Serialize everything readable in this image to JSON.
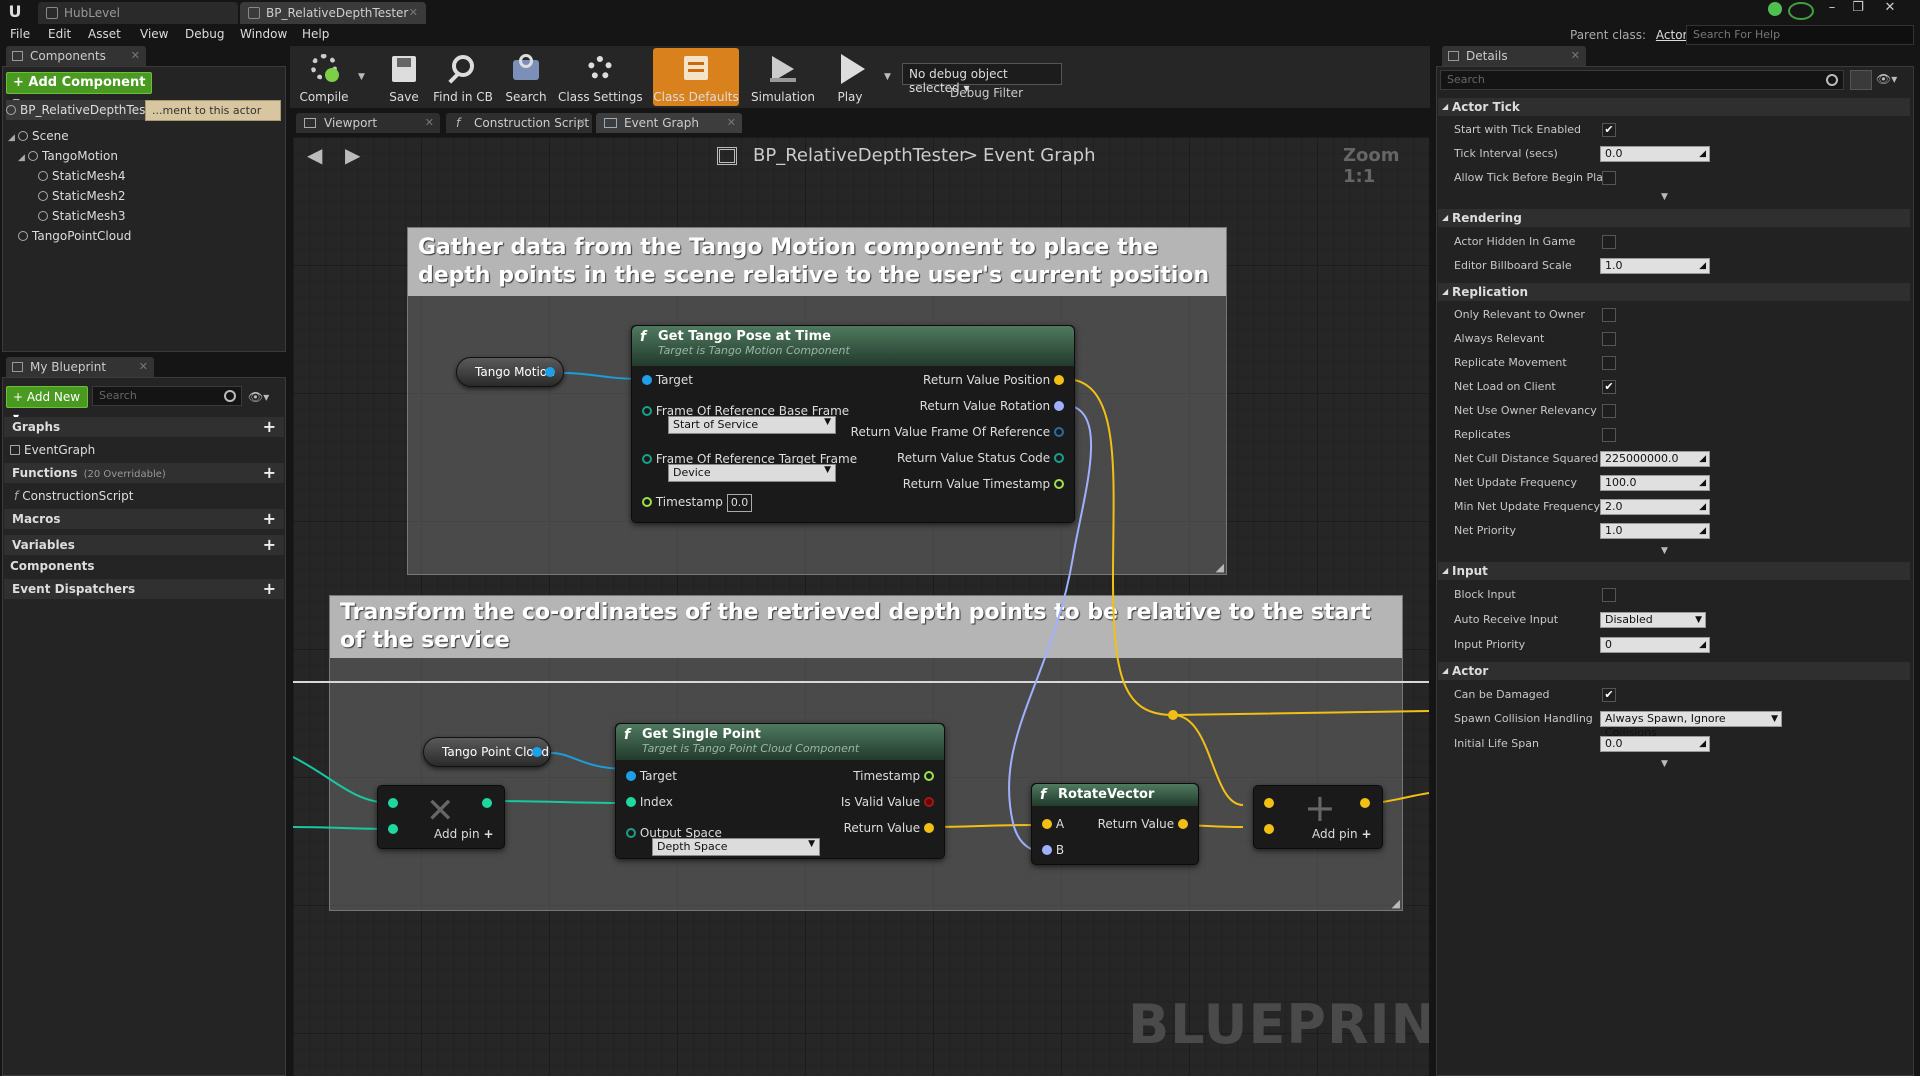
{
  "titlebar": {
    "tabs": [
      {
        "label": "HubLevel"
      },
      {
        "label": "BP_RelativeDepthTester"
      }
    ],
    "parent_class_label": "Parent class:",
    "parent_class_value": "Actor",
    "help_search_placeholder": "Search For Help"
  },
  "menu": [
    "File",
    "Edit",
    "Asset",
    "View",
    "Debug",
    "Window",
    "Help"
  ],
  "components_panel": {
    "tab": "Components",
    "add_button": "+ Add Component ▾",
    "self_item": "BP_RelativeDepthTester(self)",
    "tooltip": "...ment to this actor",
    "tree": [
      {
        "label": "Scene",
        "icon": "scene-icon"
      },
      {
        "label": "TangoMotion",
        "icon": "motion-icon"
      },
      {
        "label": "StaticMesh4",
        "icon": "mesh-icon"
      },
      {
        "label": "StaticMesh2",
        "icon": "mesh-icon"
      },
      {
        "label": "StaticMesh3",
        "icon": "mesh-icon"
      },
      {
        "label": "TangoPointCloud",
        "icon": "pointcloud-icon"
      }
    ]
  },
  "my_blueprint": {
    "tab": "My Blueprint",
    "add_new": "+ Add New ▾",
    "search_placeholder": "Search",
    "categories": {
      "graphs": "Graphs",
      "event_graph": "EventGraph",
      "functions": "Functions",
      "functions_sub": "(20 Overridable)",
      "construction_script": "ConstructionScript",
      "macros": "Macros",
      "variables": "Variables",
      "components": "Components",
      "event_dispatchers": "Event Dispatchers"
    }
  },
  "toolbar": {
    "buttons": [
      {
        "label": "Compile",
        "icon": "compile-icon"
      },
      {
        "label": "Save",
        "icon": "save-icon"
      },
      {
        "label": "Find in CB",
        "icon": "find-icon"
      },
      {
        "label": "Search",
        "icon": "search-icon"
      },
      {
        "label": "Class Settings",
        "icon": "settings-icon"
      },
      {
        "label": "Class Defaults",
        "icon": "defaults-icon",
        "active": true
      },
      {
        "label": "Simulation",
        "icon": "simulation-icon"
      },
      {
        "label": "Play",
        "icon": "play-icon"
      }
    ],
    "debug_select": "No debug object selected ▾",
    "debug_label": "Debug Filter"
  },
  "editor_tabs": [
    "Viewport",
    "Construction Script",
    "Event Graph"
  ],
  "graph": {
    "breadcrumb_root": "BP_RelativeDepthTester",
    "breadcrumb_sep": ">",
    "breadcrumb_leaf": "Event Graph",
    "zoom": "Zoom 1:1",
    "watermark": "BLUEPRINT",
    "comment1": "Gather data from the Tango Motion component to place the depth points in the scene relative to the user's current position",
    "comment2": "Transform the co-ordinates of the retrieved depth points to be relative to the start of the service",
    "var_tango_motion": "Tango Motion",
    "var_tango_point_cloud": "Tango Point Cloud",
    "node_pose": {
      "title": "Get Tango Pose at Time",
      "subtitle": "Target is Tango Motion Component",
      "target": "Target",
      "base_frame_label": "Frame Of Reference Base Frame",
      "base_frame_value": "Start of Service",
      "target_frame_label": "Frame Of Reference Target Frame",
      "target_frame_value": "Device",
      "timestamp": "Timestamp",
      "timestamp_value": "0.0",
      "out_position": "Return Value Position",
      "out_rotation": "Return Value Rotation",
      "out_frame": "Return Value Frame Of Reference",
      "out_status": "Return Value Status Code",
      "out_timestamp": "Return Value Timestamp"
    },
    "node_point": {
      "title": "Get Single Point",
      "subtitle": "Target is Tango Point Cloud Component",
      "target": "Target",
      "index": "Index",
      "output_space_label": "Output Space",
      "output_space_value": "Depth Space",
      "out_timestamp": "Timestamp",
      "out_valid": "Is Valid Value",
      "out_return": "Return Value"
    },
    "node_rotate": {
      "title": "RotateVector",
      "a": "A",
      "b": "B",
      "out_return": "Return Value"
    },
    "add_pin": "Add pin"
  },
  "details": {
    "tab": "Details",
    "search_placeholder": "Search",
    "sections": {
      "actor_tick": "Actor Tick",
      "rendering": "Rendering",
      "replication": "Replication",
      "input": "Input",
      "actor": "Actor"
    },
    "rows": {
      "start_tick": "Start with Tick Enabled",
      "tick_interval": "Tick Interval (secs)",
      "tick_interval_value": "0.0",
      "allow_tick": "Allow Tick Before Begin Play",
      "hidden": "Actor Hidden In Game",
      "billboard": "Editor Billboard Scale",
      "billboard_value": "1.0",
      "only_relevant": "Only Relevant to Owner",
      "always_relevant": "Always Relevant",
      "rep_movement": "Replicate Movement",
      "net_load": "Net Load on Client",
      "net_owner": "Net Use Owner Relevancy",
      "replicates": "Replicates",
      "cull": "Net Cull Distance Squared",
      "cull_value": "225000000.0",
      "update_freq": "Net Update Frequency",
      "update_freq_value": "100.0",
      "min_update": "Min Net Update Frequency",
      "min_update_value": "2.0",
      "priority": "Net Priority",
      "priority_value": "1.0",
      "block_input": "Block Input",
      "auto_receive": "Auto Receive Input",
      "auto_receive_value": "Disabled",
      "input_priority": "Input Priority",
      "input_priority_value": "0",
      "can_damage": "Can be Damaged",
      "spawn_collision": "Spawn Collision Handling Me",
      "spawn_collision_value": "Always Spawn, Ignore Collisions",
      "life_span": "Initial Life Span",
      "life_span_value": "0.0"
    },
    "checked": {
      "start_tick": true,
      "allow_tick": false,
      "hidden": false,
      "only_relevant": false,
      "always_relevant": false,
      "rep_movement": false,
      "net_load": true,
      "net_owner": false,
      "replicates": false,
      "block_input": false,
      "can_damage": true
    }
  }
}
